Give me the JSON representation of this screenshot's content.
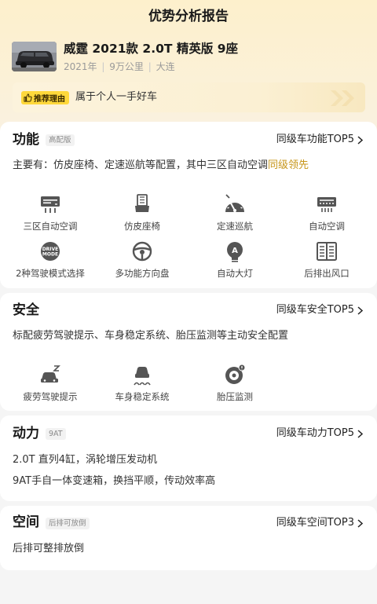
{
  "header": {
    "title": "优势分析报告"
  },
  "car": {
    "name": "威霆 2021款 2.0T 精英版 9座",
    "year": "2021年",
    "mileage": "9万公里",
    "city": "大连",
    "thumbnail_icon": "van-photo"
  },
  "reason": {
    "badge_label": "推荐理由",
    "badge_icon": "thumbs-up-icon",
    "text": "属于个人一手好车"
  },
  "sections": {
    "function": {
      "title": "功能",
      "tag": "高配版",
      "link": "同级车功能TOP5",
      "desc_prefix": "主要有：仿皮座椅、定速巡航等配置，其中三区自动空调",
      "desc_highlight": "同级领先",
      "features": [
        {
          "label": "三区自动空调",
          "icon": "tri-zone-ac-icon"
        },
        {
          "label": "仿皮座椅",
          "icon": "leather-seat-icon"
        },
        {
          "label": "定速巡航",
          "icon": "cruise-control-icon"
        },
        {
          "label": "自动空调",
          "icon": "auto-ac-icon"
        },
        {
          "label": "2种驾驶模式选择",
          "icon": "drive-mode-icon",
          "icon_text": "DRIVE MODE"
        },
        {
          "label": "多功能方向盘",
          "icon": "steering-wheel-icon"
        },
        {
          "label": "自动大灯",
          "icon": "auto-headlight-icon",
          "icon_text": "A"
        },
        {
          "label": "后排出风口",
          "icon": "rear-vent-icon"
        }
      ]
    },
    "safety": {
      "title": "安全",
      "link": "同级车安全TOP5",
      "desc": "标配疲劳驾驶提示、车身稳定系统、胎压监测等主动安全配置",
      "features": [
        {
          "label": "疲劳驾驶提示",
          "icon": "fatigue-alert-icon"
        },
        {
          "label": "车身稳定系统",
          "icon": "stability-control-icon"
        },
        {
          "label": "胎压监测",
          "icon": "tire-pressure-icon"
        }
      ]
    },
    "power": {
      "title": "动力",
      "tag": "9AT",
      "link": "同级车动力TOP5",
      "lines": [
        "2.0T 直列4缸，涡轮增压发动机",
        "9AT手自一体变速箱，换挡平顺，传动效率高"
      ]
    },
    "space": {
      "title": "空间",
      "tag": "后排可放倒",
      "link": "同级车空间TOP3",
      "desc": "后排可整排放倒"
    }
  },
  "colors": {
    "accent": "#c7961a",
    "badge": "#ffd83b",
    "hero_bg": "#fdf0cc"
  }
}
